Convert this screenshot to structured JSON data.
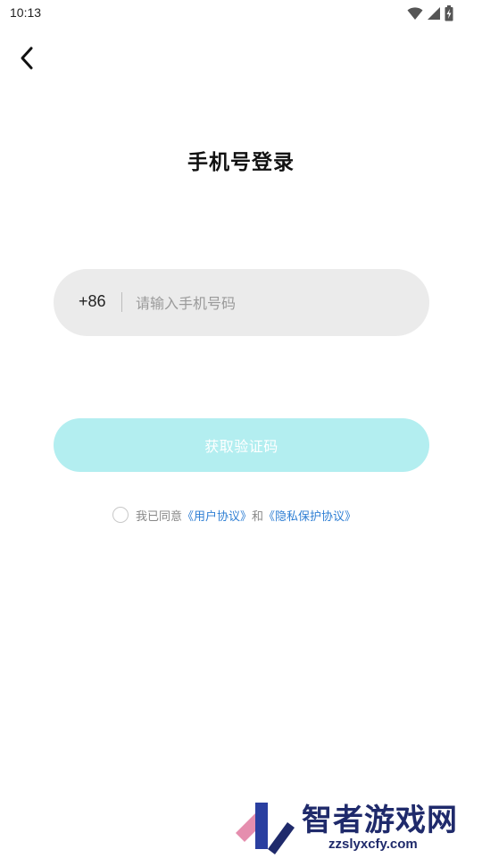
{
  "status_bar": {
    "time": "10:13",
    "icons": [
      "wifi-icon",
      "signal-icon",
      "battery-icon"
    ]
  },
  "nav": {
    "back_icon": "chevron-left-icon"
  },
  "title": "手机号登录",
  "phone_field": {
    "country_code": "+86",
    "placeholder": "请输入手机号码",
    "value": ""
  },
  "get_code_button": {
    "label": "获取验证码",
    "enabled": false,
    "color": "#b3eef0"
  },
  "agreement": {
    "checked": false,
    "prefix": "我已同意",
    "user_agreement": "《用户协议》",
    "conjunction": "和",
    "privacy_policy": "《隐私保护协议》",
    "link_color": "#2f7fd4"
  },
  "watermark": {
    "name": "智者游戏网",
    "url": "zzslyxcfy.com"
  }
}
